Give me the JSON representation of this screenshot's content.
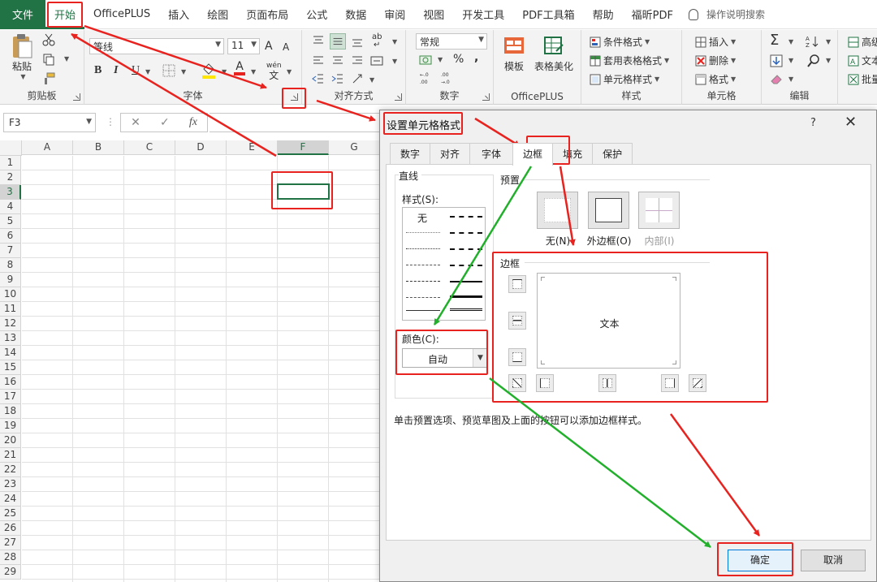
{
  "menubar": {
    "file": "文件",
    "tabs": [
      "开始",
      "OfficePLUS",
      "插入",
      "绘图",
      "页面布局",
      "公式",
      "数据",
      "审阅",
      "视图",
      "开发工具",
      "PDF工具箱",
      "帮助",
      "福昕PDF"
    ],
    "active_tab": "开始",
    "search_placeholder": "操作说明搜索"
  },
  "ribbon": {
    "clipboard": {
      "label": "剪贴板",
      "paste": "粘贴"
    },
    "font": {
      "label": "字体",
      "font_name": "等线",
      "font_size": "11",
      "grow": "A",
      "shrink": "A",
      "bold": "B",
      "italic": "I",
      "underline": "U",
      "font_color": "A",
      "phonetic": "wén"
    },
    "alignment": {
      "label": "对齐方式",
      "wrap_label": "ab"
    },
    "number": {
      "label": "数字",
      "format": "常规",
      "percent": "%",
      "comma": ","
    },
    "officeplus": {
      "label": "OfficePLUS",
      "template": "模板",
      "beautify": "表格美化"
    },
    "styles": {
      "label": "样式",
      "conditional": "条件格式",
      "table_format": "套用表格格式",
      "cell_styles": "单元格样式"
    },
    "cells": {
      "label": "单元格",
      "insert": "插入",
      "delete": "删除",
      "format": "格式"
    },
    "editing": {
      "label": "编辑"
    },
    "partial": {
      "item1": "高级",
      "item2": "文本",
      "item3": "批量"
    }
  },
  "formula_bar": {
    "name_box": "F3",
    "fx": "fx"
  },
  "grid": {
    "columns": [
      "A",
      "B",
      "C",
      "D",
      "E",
      "F",
      "G"
    ],
    "selected_column": "F",
    "rows": [
      "1",
      "2",
      "3",
      "4",
      "5",
      "6",
      "7",
      "8",
      "9",
      "10",
      "11",
      "12",
      "13",
      "14",
      "15",
      "16",
      "17",
      "18",
      "19",
      "20",
      "21",
      "22",
      "23",
      "24",
      "25",
      "26",
      "27",
      "28",
      "29"
    ],
    "selected_row": "3"
  },
  "dialog": {
    "title": "设置单元格格式",
    "help": "?",
    "close": "✕",
    "tabs": [
      "数字",
      "对齐",
      "字体",
      "边框",
      "填充",
      "保护"
    ],
    "active_tab": "边框",
    "line_section": "直线",
    "style_label": "样式(S):",
    "style_none": "无",
    "color_label": "颜色(C):",
    "color_value": "自动",
    "preset_section": "预置",
    "presets": [
      "无(N)",
      "外边框(O)",
      "内部(I)"
    ],
    "border_section": "边框",
    "preview_text": "文本",
    "hint": "单击预置选项、预览草图及上面的按钮可以添加边框样式。",
    "ok": "确定",
    "cancel": "取消"
  },
  "colors": {
    "excel_green": "#217346",
    "annotation_red": "#e8231f",
    "annotation_green": "#22b02c"
  }
}
